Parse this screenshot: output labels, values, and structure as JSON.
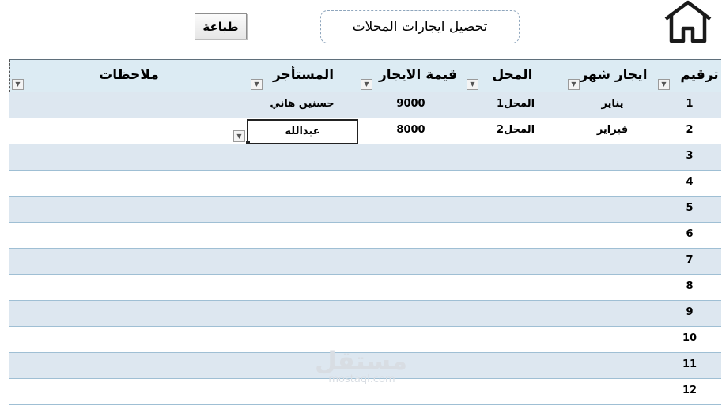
{
  "toolbar": {
    "print_label": "طباعة"
  },
  "title": "تحصيل ايجارات المحلات",
  "icons": {
    "home": "home-icon",
    "filter": "dropdown-arrow-icon"
  },
  "table": {
    "headers": {
      "num": "ترقيم",
      "month": "ايجار شهر",
      "shop": "المحل",
      "rent": "قيمة الايجار",
      "tenant": "المستأجر",
      "notes": "ملاحظات"
    },
    "rows": [
      {
        "num": "1",
        "month": "يناير",
        "shop": "المحل1",
        "rent": "9000",
        "tenant": "حسنين هاني",
        "notes": ""
      },
      {
        "num": "2",
        "month": "فبراير",
        "shop": "المحل2",
        "rent": "8000",
        "tenant": "عبدالله",
        "notes": ""
      },
      {
        "num": "3",
        "month": "",
        "shop": "",
        "rent": "",
        "tenant": "",
        "notes": ""
      },
      {
        "num": "4",
        "month": "",
        "shop": "",
        "rent": "",
        "tenant": "",
        "notes": ""
      },
      {
        "num": "5",
        "month": "",
        "shop": "",
        "rent": "",
        "tenant": "",
        "notes": ""
      },
      {
        "num": "6",
        "month": "",
        "shop": "",
        "rent": "",
        "tenant": "",
        "notes": ""
      },
      {
        "num": "7",
        "month": "",
        "shop": "",
        "rent": "",
        "tenant": "",
        "notes": ""
      },
      {
        "num": "8",
        "month": "",
        "shop": "",
        "rent": "",
        "tenant": "",
        "notes": ""
      },
      {
        "num": "9",
        "month": "",
        "shop": "",
        "rent": "",
        "tenant": "",
        "notes": ""
      },
      {
        "num": "10",
        "month": "",
        "shop": "",
        "rent": "",
        "tenant": "",
        "notes": ""
      },
      {
        "num": "11",
        "month": "",
        "shop": "",
        "rent": "",
        "tenant": "",
        "notes": ""
      },
      {
        "num": "12",
        "month": "",
        "shop": "",
        "rent": "",
        "tenant": "",
        "notes": ""
      }
    ]
  },
  "watermark": {
    "arabic": "مستقل",
    "latin": "mostaql.com"
  },
  "colors": {
    "header_bg": "#dcebf3",
    "band": "#dde7f0",
    "row_border": "#9fbfd4"
  }
}
